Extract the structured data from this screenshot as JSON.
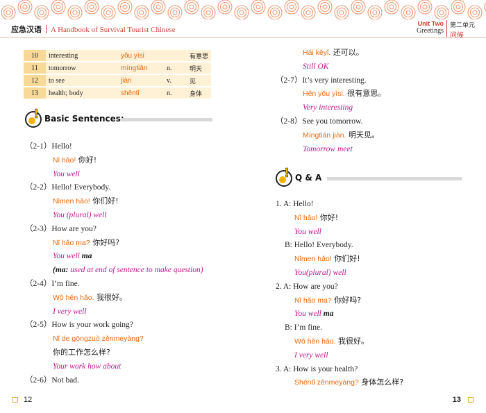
{
  "header": {
    "left_cn": "应急汉语",
    "left_en": "A Handbook of Survival Tourist Chinese",
    "unit_en": "Unit Two",
    "unit_title_en": "Greetings",
    "unit_cn": "第二单元",
    "unit_title_cn": "问候"
  },
  "vocab": [
    {
      "num": "10",
      "en": "interesting",
      "py": "yǒu yìsi",
      "pos": "",
      "cn": "有意思"
    },
    {
      "num": "11",
      "en": "tomorrow",
      "py": "míngtiān",
      "pos": "n.",
      "cn": "明天"
    },
    {
      "num": "12",
      "en": "to see",
      "py": "jiàn",
      "pos": "v.",
      "cn": "见"
    },
    {
      "num": "13",
      "en": "health; body",
      "py": "shēntǐ",
      "pos": "n.",
      "cn": "身体"
    }
  ],
  "sections": {
    "basic": "Basic Sentences:",
    "qa": "Q & A"
  },
  "left_lines": [
    {
      "t": "en",
      "text": "（2-1）Hello!"
    },
    {
      "t": "py",
      "py": "Nǐ hǎo!",
      "cn": "你好!"
    },
    {
      "t": "tr",
      "text": "You well"
    },
    {
      "t": "en",
      "text": "（2-2）Hello! Everybody."
    },
    {
      "t": "py",
      "py": "Nǐmen hǎo!",
      "cn": "你们好!"
    },
    {
      "t": "tr",
      "text": "You (plural) well"
    },
    {
      "t": "en",
      "text": "（2-3）How are you?"
    },
    {
      "t": "py",
      "py": "Nǐ hǎo ma?",
      "cn": "你好吗?"
    },
    {
      "t": "tr",
      "text": "You well",
      "bold": "ma"
    },
    {
      "t": "tr",
      "bold": "(ma:",
      "text": "used at end of sentence to make question)"
    },
    {
      "t": "en",
      "text": "（2-4）I’m fine."
    },
    {
      "t": "py",
      "py": "Wǒ hěn hǎo.",
      "cn": "我很好。"
    },
    {
      "t": "tr",
      "text": "I very well"
    },
    {
      "t": "en",
      "text": "（2-5）How is your work going?"
    },
    {
      "t": "py",
      "py": "Nǐ de gōngzuò zěnmeyàng?",
      "cn": ""
    },
    {
      "t": "cn",
      "text": "你的工作怎么样?"
    },
    {
      "t": "tr",
      "text": "Your work how about"
    },
    {
      "t": "en",
      "text": "（2-6）Not bad."
    }
  ],
  "right_lines": [
    {
      "t": "py",
      "py": "Hái kěyǐ.",
      "cn": "还可以。"
    },
    {
      "t": "tr",
      "text": "Still OK"
    },
    {
      "t": "en",
      "text": "（2-7）It’s very interesting."
    },
    {
      "t": "py",
      "py": "Hěn yǒu yìsi.",
      "cn": "很有意思。"
    },
    {
      "t": "tr",
      "text": "Very interesting"
    },
    {
      "t": "en",
      "text": "（2-8）See you tomorrow."
    },
    {
      "t": "py",
      "py": "Míngtiān jiàn.",
      "cn": "明天见。"
    },
    {
      "t": "tr",
      "text": "Tomorrow meet"
    }
  ],
  "qa_lines": [
    {
      "t": "en",
      "text": "1. A: Hello!"
    },
    {
      "t": "py",
      "py": "Nǐ hǎo!",
      "cn": "你好!"
    },
    {
      "t": "tr",
      "text": "You well"
    },
    {
      "t": "en",
      "text": "B: Hello! Everybody."
    },
    {
      "t": "py",
      "py": "Nǐmen hǎo!",
      "cn": "你们好!"
    },
    {
      "t": "tr",
      "text": "You(plural) well"
    },
    {
      "t": "en",
      "text": "2. A: How are you?"
    },
    {
      "t": "py",
      "py": "Nǐ hǎo ma?",
      "cn": "你好吗?"
    },
    {
      "t": "tr",
      "text": "You well",
      "bold": "ma"
    },
    {
      "t": "en",
      "text": "B: I’m fine."
    },
    {
      "t": "py",
      "py": "Wǒ hěn hǎo.",
      "cn": "我很好。"
    },
    {
      "t": "tr",
      "text": "I very well"
    },
    {
      "t": "en",
      "text": "3. A: How is your health?"
    },
    {
      "t": "py",
      "py": "Shēntǐ zěnmeyàng?",
      "cn": "身体怎么样?"
    }
  ],
  "page_left": "12",
  "page_right": "13"
}
